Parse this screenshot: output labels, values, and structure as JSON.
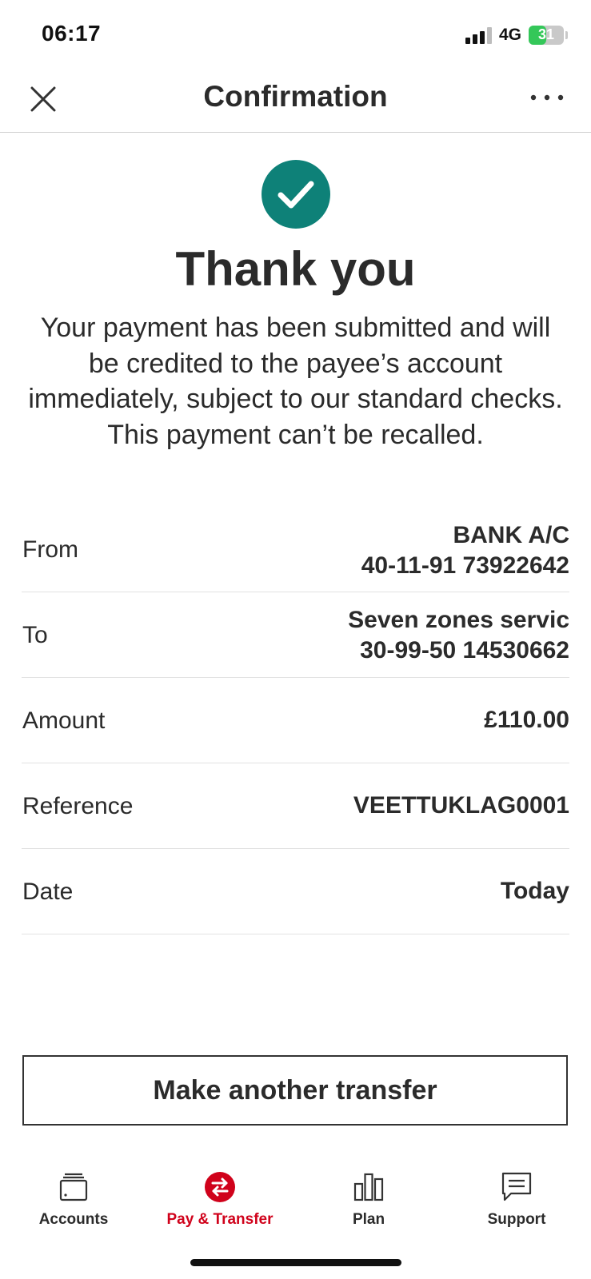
{
  "status_bar": {
    "time": "06:17",
    "network": "4G",
    "battery_percent": "31",
    "battery_level": 0.31
  },
  "header": {
    "title": "Confirmation",
    "close_icon": "close-icon",
    "more_icon": "more-horizontal-icon"
  },
  "confirmation": {
    "icon": "checkmark-circle-icon",
    "accent_color": "#0e8178",
    "title": "Thank you",
    "message": "Your payment has been submitted and will be credited to the payee’s account immediately, subject to our standard checks. This payment can’t be recalled."
  },
  "details": {
    "from": {
      "label": "From",
      "line1": "BANK A/C",
      "line2": "40-11-91 73922642"
    },
    "to": {
      "label": "To",
      "line1": "Seven zones servic",
      "line2": "30-99-50 14530662"
    },
    "amount": {
      "label": "Amount",
      "value": "£110.00"
    },
    "reference": {
      "label": "Reference",
      "value": "VEETTUKLAG0001"
    },
    "date": {
      "label": "Date",
      "value": "Today"
    }
  },
  "actions": {
    "make_another_transfer": "Make another transfer"
  },
  "bottom_nav": {
    "active_color": "#d0021b",
    "items": [
      {
        "label": "Accounts",
        "icon": "wallet-icon"
      },
      {
        "label": "Pay & Transfer",
        "icon": "transfer-arrows-icon",
        "active": true
      },
      {
        "label": "Plan",
        "icon": "bar-chart-icon"
      },
      {
        "label": "Support",
        "icon": "chat-bubble-icon"
      }
    ]
  }
}
